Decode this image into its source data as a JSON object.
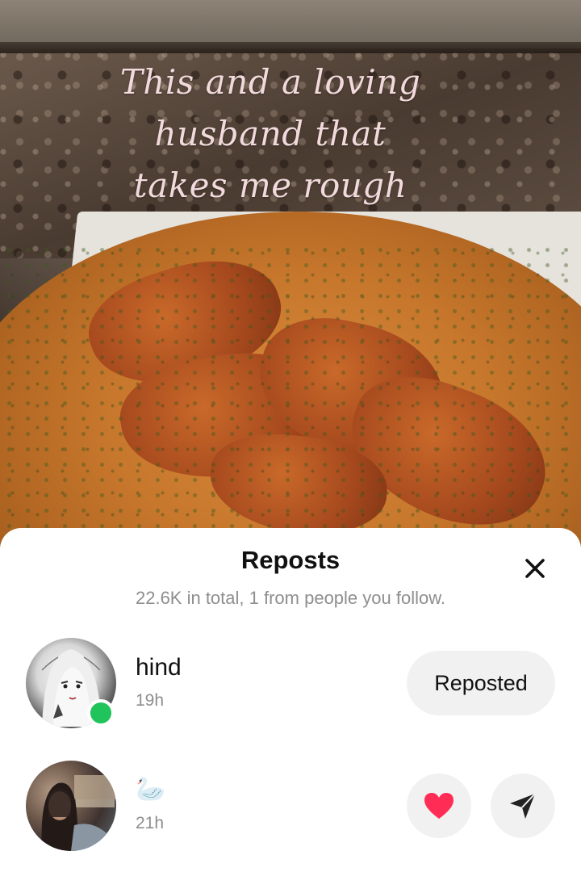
{
  "post": {
    "caption_line1": "This and a loving",
    "caption_line2": "husband that",
    "caption_line3": "takes me rough"
  },
  "sheet": {
    "title": "Reposts",
    "subtitle": "22.6K in total, 1 from people you follow."
  },
  "reposts": [
    {
      "username": "hind",
      "time": "19h",
      "online": true,
      "action_label": "Reposted"
    },
    {
      "username": "🦢",
      "time": "21h"
    }
  ],
  "colors": {
    "online": "#21c35b",
    "heart": "#ff2d55",
    "caption": "#f2d9dc",
    "button_bg": "#f1f1f2"
  },
  "icons": [
    "close-icon",
    "heart-icon",
    "send-icon"
  ]
}
